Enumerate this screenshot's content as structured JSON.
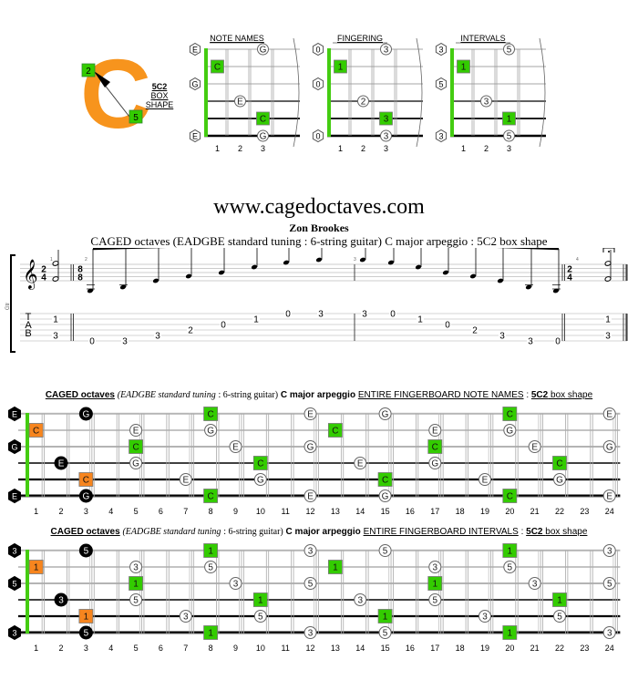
{
  "shape_badge": {
    "letter": "C",
    "letter_color": "#f7941d",
    "marker_top": "2",
    "marker_bottom": "5",
    "label_code": "5C2",
    "label_line2": "BOX",
    "label_line3": "SHAPE"
  },
  "colors": {
    "green": "#33cc00",
    "orange": "#f7851e",
    "nut": "#44cc11"
  },
  "small_diagrams": [
    {
      "title": "NOTE NAMES",
      "open": [
        "E",
        "",
        "G",
        "",
        "",
        "E"
      ],
      "notes": [
        {
          "string": 1,
          "fret": 3,
          "label": "G",
          "style": "circle"
        },
        {
          "string": 2,
          "fret": 1,
          "label": "C",
          "style": "green"
        },
        {
          "string": 4,
          "fret": 2,
          "label": "E",
          "style": "circle"
        },
        {
          "string": 5,
          "fret": 3,
          "label": "C",
          "style": "green"
        },
        {
          "string": 6,
          "fret": 3,
          "label": "G",
          "style": "circle"
        }
      ],
      "fret_numbers": [
        "1",
        "2",
        "3"
      ]
    },
    {
      "title": "FINGERING",
      "open": [
        "0",
        "",
        "0",
        "",
        "",
        "0"
      ],
      "notes": [
        {
          "string": 1,
          "fret": 3,
          "label": "3",
          "style": "circle"
        },
        {
          "string": 2,
          "fret": 1,
          "label": "1",
          "style": "green"
        },
        {
          "string": 4,
          "fret": 2,
          "label": "2",
          "style": "circle"
        },
        {
          "string": 5,
          "fret": 3,
          "label": "3",
          "style": "green"
        },
        {
          "string": 6,
          "fret": 3,
          "label": "3",
          "style": "circle"
        }
      ],
      "fret_numbers": [
        "1",
        "2",
        "3"
      ]
    },
    {
      "title": "INTERVALS",
      "open": [
        "3",
        "",
        "5",
        "",
        "",
        "3"
      ],
      "notes": [
        {
          "string": 1,
          "fret": 3,
          "label": "5",
          "style": "circle"
        },
        {
          "string": 2,
          "fret": 1,
          "label": "1",
          "style": "green"
        },
        {
          "string": 4,
          "fret": 2,
          "label": "3",
          "style": "circle"
        },
        {
          "string": 5,
          "fret": 3,
          "label": "1",
          "style": "green"
        },
        {
          "string": 6,
          "fret": 3,
          "label": "5",
          "style": "circle"
        }
      ],
      "fret_numbers": [
        "1",
        "2",
        "3"
      ]
    }
  ],
  "header": {
    "site": "www.cagedoctaves.com",
    "author": "Zon Brookes",
    "subtitle": "CAGED octaves (EADGBE standard tuning : 6-string guitar) C major arpeggio : 5C2 box shape"
  },
  "score": {
    "staff_label": "Gtr",
    "time_sig_start": [
      "2",
      "4"
    ],
    "time_sig_mid": [
      "8",
      "8"
    ],
    "time_sig_end": [
      "2",
      "4"
    ],
    "measure_numbers": [
      "1",
      "2",
      "3",
      "4"
    ],
    "tab_letters": [
      "T",
      "A",
      "B"
    ],
    "measures": [
      {
        "tab": [
          {
            "string": 2,
            "fret": "1"
          },
          {
            "string": 5,
            "fret": "3"
          }
        ],
        "chord": true
      },
      {
        "tab": [
          {
            "string": 6,
            "fret": "0"
          },
          {
            "string": 6,
            "fret": "3"
          },
          {
            "string": 5,
            "fret": "3"
          },
          {
            "string": 4,
            "fret": "2"
          },
          {
            "string": 3,
            "fret": "0"
          },
          {
            "string": 2,
            "fret": "1"
          },
          {
            "string": 1,
            "fret": "0"
          },
          {
            "string": 1,
            "fret": "3"
          }
        ]
      },
      {
        "tab": [
          {
            "string": 1,
            "fret": "3"
          },
          {
            "string": 1,
            "fret": "0"
          },
          {
            "string": 2,
            "fret": "1"
          },
          {
            "string": 3,
            "fret": "0"
          },
          {
            "string": 4,
            "fret": "2"
          },
          {
            "string": 5,
            "fret": "3"
          },
          {
            "string": 6,
            "fret": "3"
          },
          {
            "string": 6,
            "fret": "0"
          }
        ]
      },
      {
        "tab": [
          {
            "string": 2,
            "fret": "1"
          },
          {
            "string": 5,
            "fret": "3"
          }
        ],
        "chord": true
      }
    ]
  },
  "fingerboards": [
    {
      "title_parts": {
        "a": "CAGED octaves",
        "b": "(EADGBE standard tuning",
        "c": ": 6-string guitar)",
        "d": "C major arpeggio",
        "e": "ENTIRE FINGERBOARD  NOTE NAMES",
        "f": ":",
        "g": "5C2",
        "h": "box shape"
      },
      "open": [
        "E",
        "",
        "G",
        "",
        "",
        "E"
      ],
      "notes": [
        {
          "s": 1,
          "f": 3,
          "l": "G",
          "t": "black"
        },
        {
          "s": 1,
          "f": 8,
          "l": "C",
          "t": "green"
        },
        {
          "s": 1,
          "f": 12,
          "l": "E",
          "t": "circle"
        },
        {
          "s": 1,
          "f": 15,
          "l": "G",
          "t": "circle"
        },
        {
          "s": 1,
          "f": 20,
          "l": "C",
          "t": "green"
        },
        {
          "s": 1,
          "f": 24,
          "l": "E",
          "t": "circle"
        },
        {
          "s": 2,
          "f": 1,
          "l": "C",
          "t": "orange"
        },
        {
          "s": 2,
          "f": 5,
          "l": "E",
          "t": "circle"
        },
        {
          "s": 2,
          "f": 8,
          "l": "G",
          "t": "circle"
        },
        {
          "s": 2,
          "f": 13,
          "l": "C",
          "t": "green"
        },
        {
          "s": 2,
          "f": 17,
          "l": "E",
          "t": "circle"
        },
        {
          "s": 2,
          "f": 20,
          "l": "G",
          "t": "circle"
        },
        {
          "s": 3,
          "f": 5,
          "l": "C",
          "t": "green"
        },
        {
          "s": 3,
          "f": 9,
          "l": "E",
          "t": "circle"
        },
        {
          "s": 3,
          "f": 12,
          "l": "G",
          "t": "circle"
        },
        {
          "s": 3,
          "f": 17,
          "l": "C",
          "t": "green"
        },
        {
          "s": 3,
          "f": 21,
          "l": "E",
          "t": "circle"
        },
        {
          "s": 3,
          "f": 24,
          "l": "G",
          "t": "circle"
        },
        {
          "s": 4,
          "f": 2,
          "l": "E",
          "t": "black"
        },
        {
          "s": 4,
          "f": 5,
          "l": "G",
          "t": "circle"
        },
        {
          "s": 4,
          "f": 10,
          "l": "C",
          "t": "green"
        },
        {
          "s": 4,
          "f": 14,
          "l": "E",
          "t": "circle"
        },
        {
          "s": 4,
          "f": 17,
          "l": "G",
          "t": "circle"
        },
        {
          "s": 4,
          "f": 22,
          "l": "C",
          "t": "green"
        },
        {
          "s": 5,
          "f": 3,
          "l": "C",
          "t": "orange"
        },
        {
          "s": 5,
          "f": 7,
          "l": "E",
          "t": "circle"
        },
        {
          "s": 5,
          "f": 10,
          "l": "G",
          "t": "circle"
        },
        {
          "s": 5,
          "f": 15,
          "l": "C",
          "t": "green"
        },
        {
          "s": 5,
          "f": 19,
          "l": "E",
          "t": "circle"
        },
        {
          "s": 5,
          "f": 22,
          "l": "G",
          "t": "circle"
        },
        {
          "s": 6,
          "f": 3,
          "l": "G",
          "t": "black"
        },
        {
          "s": 6,
          "f": 8,
          "l": "C",
          "t": "green"
        },
        {
          "s": 6,
          "f": 12,
          "l": "E",
          "t": "circle"
        },
        {
          "s": 6,
          "f": 15,
          "l": "G",
          "t": "circle"
        },
        {
          "s": 6,
          "f": 20,
          "l": "C",
          "t": "green"
        },
        {
          "s": 6,
          "f": 24,
          "l": "E",
          "t": "circle"
        }
      ],
      "fret_numbers": [
        "1",
        "2",
        "3",
        "4",
        "5",
        "6",
        "7",
        "8",
        "9",
        "10",
        "11",
        "12",
        "13",
        "14",
        "15",
        "16",
        "17",
        "18",
        "19",
        "20",
        "21",
        "22",
        "23",
        "24"
      ]
    },
    {
      "title_parts": {
        "a": "CAGED octaves",
        "b": "(EADGBE standard tuning",
        "c": ": 6-string guitar)",
        "d": "C major arpeggio",
        "e": "ENTIRE FINGERBOARD   INTERVALS",
        "f": ":",
        "g": "5C2",
        "h": "box shape"
      },
      "open": [
        "3",
        "",
        "5",
        "",
        "",
        "3"
      ],
      "notes": [
        {
          "s": 1,
          "f": 3,
          "l": "5",
          "t": "black"
        },
        {
          "s": 1,
          "f": 8,
          "l": "1",
          "t": "green"
        },
        {
          "s": 1,
          "f": 12,
          "l": "3",
          "t": "circle"
        },
        {
          "s": 1,
          "f": 15,
          "l": "5",
          "t": "circle"
        },
        {
          "s": 1,
          "f": 20,
          "l": "1",
          "t": "green"
        },
        {
          "s": 1,
          "f": 24,
          "l": "3",
          "t": "circle"
        },
        {
          "s": 2,
          "f": 1,
          "l": "1",
          "t": "orange"
        },
        {
          "s": 2,
          "f": 5,
          "l": "3",
          "t": "circle"
        },
        {
          "s": 2,
          "f": 8,
          "l": "5",
          "t": "circle"
        },
        {
          "s": 2,
          "f": 13,
          "l": "1",
          "t": "green"
        },
        {
          "s": 2,
          "f": 17,
          "l": "3",
          "t": "circle"
        },
        {
          "s": 2,
          "f": 20,
          "l": "5",
          "t": "circle"
        },
        {
          "s": 3,
          "f": 5,
          "l": "1",
          "t": "green"
        },
        {
          "s": 3,
          "f": 9,
          "l": "3",
          "t": "circle"
        },
        {
          "s": 3,
          "f": 12,
          "l": "5",
          "t": "circle"
        },
        {
          "s": 3,
          "f": 17,
          "l": "1",
          "t": "green"
        },
        {
          "s": 3,
          "f": 21,
          "l": "3",
          "t": "circle"
        },
        {
          "s": 3,
          "f": 24,
          "l": "5",
          "t": "circle"
        },
        {
          "s": 4,
          "f": 2,
          "l": "3",
          "t": "black"
        },
        {
          "s": 4,
          "f": 5,
          "l": "5",
          "t": "circle"
        },
        {
          "s": 4,
          "f": 10,
          "l": "1",
          "t": "green"
        },
        {
          "s": 4,
          "f": 14,
          "l": "3",
          "t": "circle"
        },
        {
          "s": 4,
          "f": 17,
          "l": "5",
          "t": "circle"
        },
        {
          "s": 4,
          "f": 22,
          "l": "1",
          "t": "green"
        },
        {
          "s": 5,
          "f": 3,
          "l": "1",
          "t": "orange"
        },
        {
          "s": 5,
          "f": 7,
          "l": "3",
          "t": "circle"
        },
        {
          "s": 5,
          "f": 10,
          "l": "5",
          "t": "circle"
        },
        {
          "s": 5,
          "f": 15,
          "l": "1",
          "t": "green"
        },
        {
          "s": 5,
          "f": 19,
          "l": "3",
          "t": "circle"
        },
        {
          "s": 5,
          "f": 22,
          "l": "5",
          "t": "circle"
        },
        {
          "s": 6,
          "f": 3,
          "l": "5",
          "t": "black"
        },
        {
          "s": 6,
          "f": 8,
          "l": "1",
          "t": "green"
        },
        {
          "s": 6,
          "f": 12,
          "l": "3",
          "t": "circle"
        },
        {
          "s": 6,
          "f": 15,
          "l": "5",
          "t": "circle"
        },
        {
          "s": 6,
          "f": 20,
          "l": "1",
          "t": "green"
        },
        {
          "s": 6,
          "f": 24,
          "l": "3",
          "t": "circle"
        }
      ],
      "fret_numbers": [
        "1",
        "2",
        "3",
        "4",
        "5",
        "6",
        "7",
        "8",
        "9",
        "10",
        "11",
        "12",
        "13",
        "14",
        "15",
        "16",
        "17",
        "18",
        "19",
        "20",
        "21",
        "22",
        "23",
        "24"
      ]
    }
  ]
}
